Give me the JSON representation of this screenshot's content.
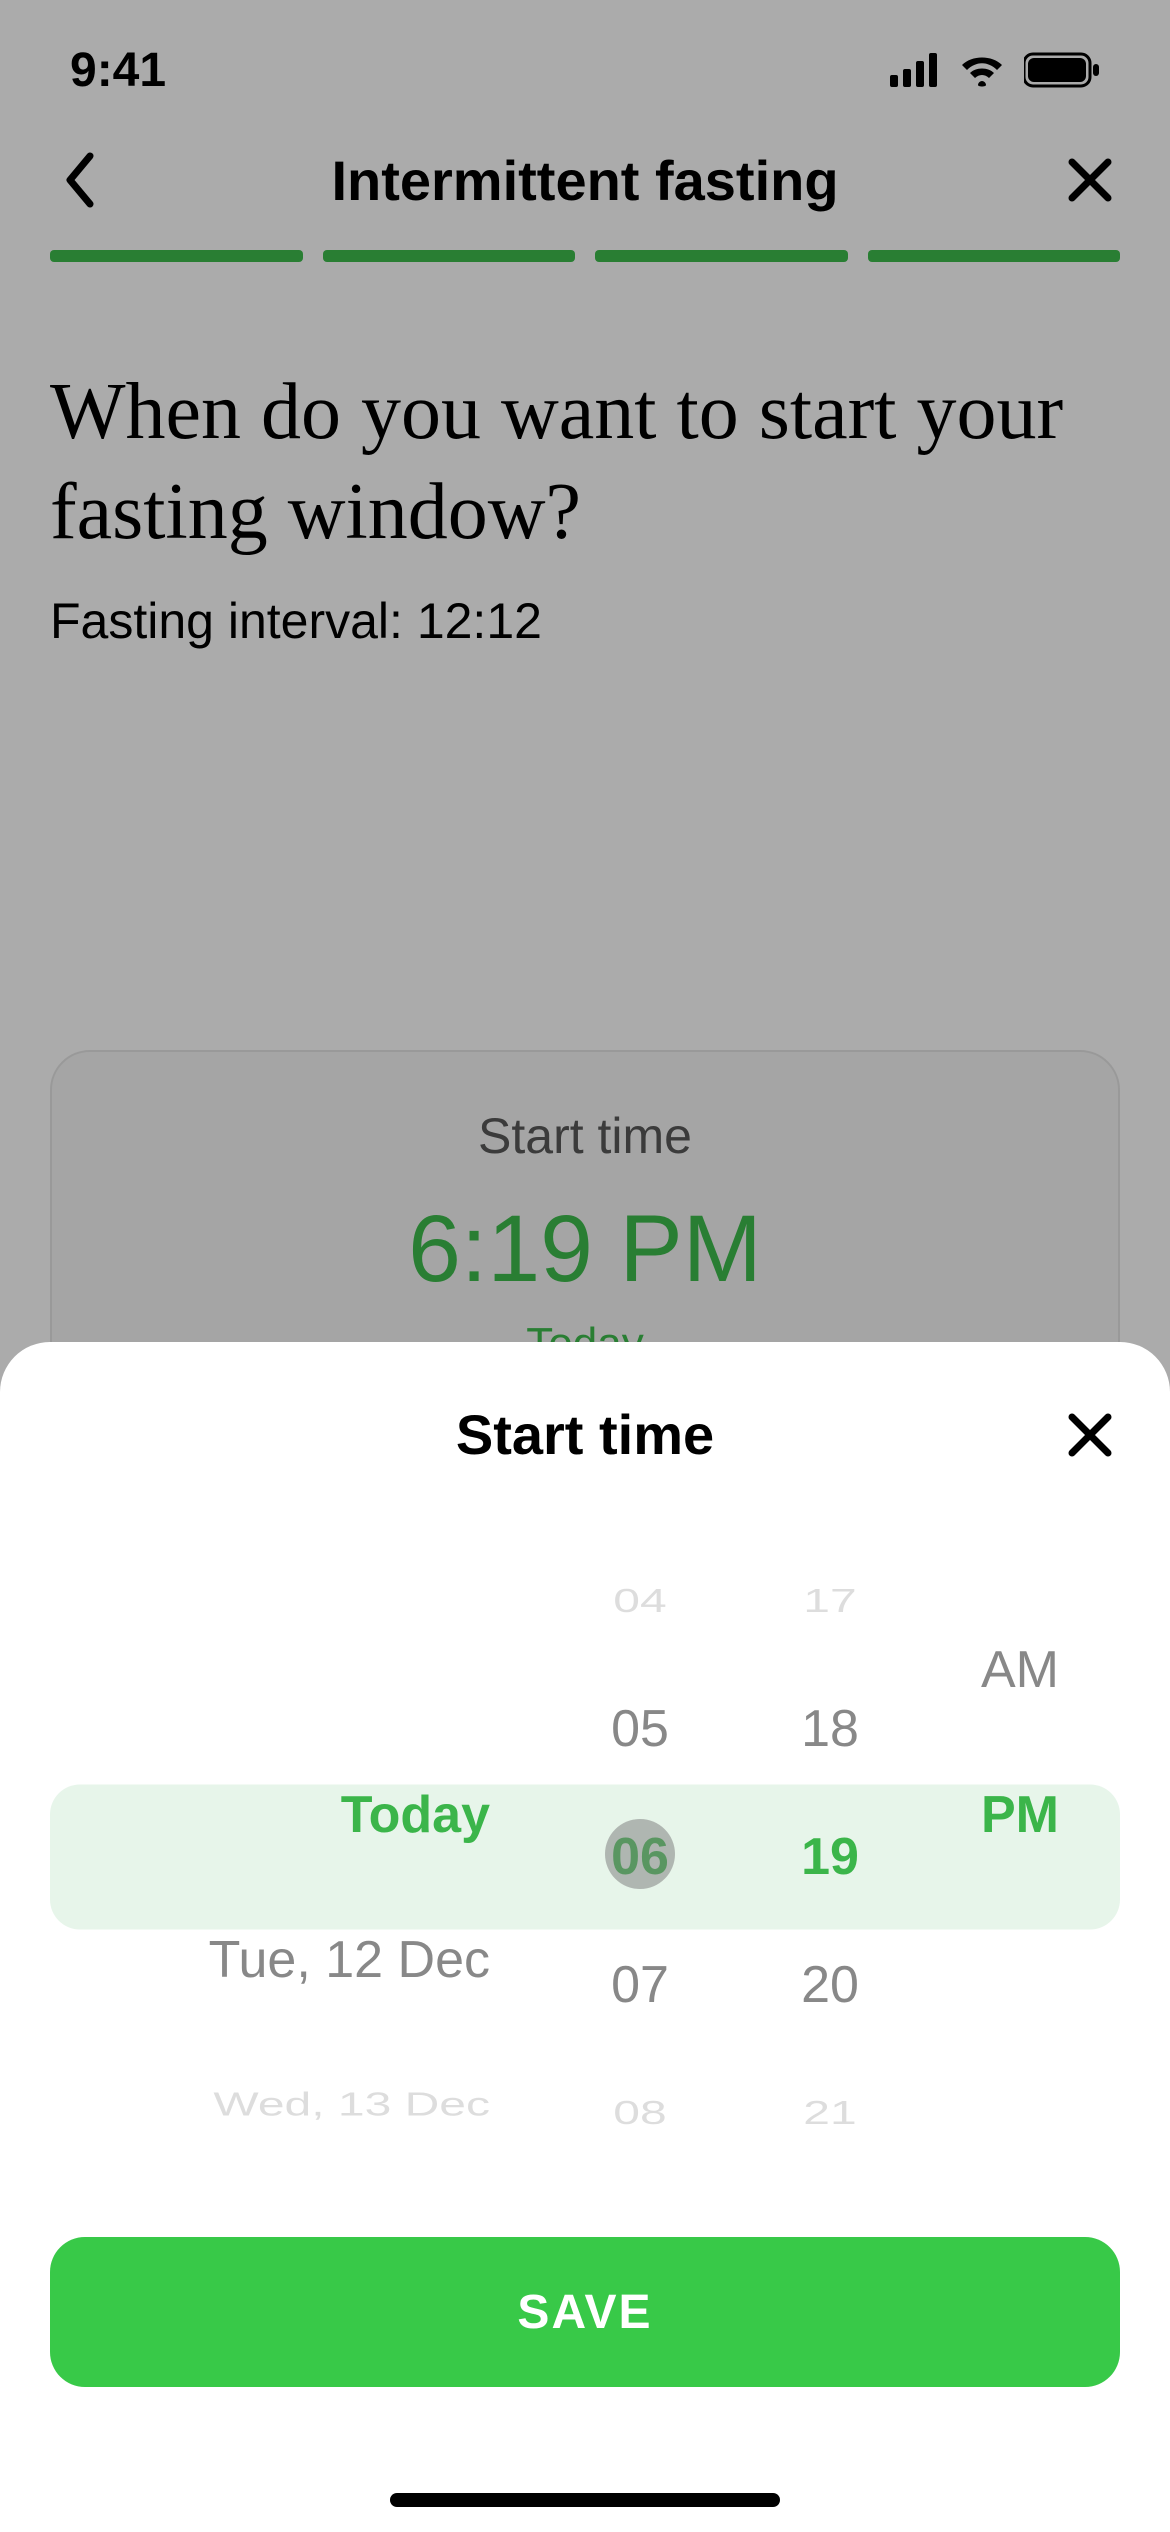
{
  "status": {
    "time": "9:41"
  },
  "nav": {
    "title": "Intermittent fasting"
  },
  "content": {
    "question": "When do you want to start your fasting window?",
    "subtitle": "Fasting interval: 12:12"
  },
  "time_card": {
    "label": "Start time",
    "value": "6:19 PM",
    "day": "Today"
  },
  "sheet": {
    "title": "Start time",
    "save_label": "SAVE",
    "picker": {
      "date": {
        "selected": "Today",
        "next1": "Tue, 12 Dec",
        "next2": "Wed, 13 Dec"
      },
      "hour": {
        "prev2": "04",
        "prev1": "05",
        "selected": "06",
        "next1": "07",
        "next2": "08"
      },
      "minute": {
        "prev2": "17",
        "prev1": "18",
        "selected": "19",
        "next1": "20",
        "next2": "21"
      },
      "ampm": {
        "prev1": "AM",
        "selected": "PM"
      }
    }
  }
}
